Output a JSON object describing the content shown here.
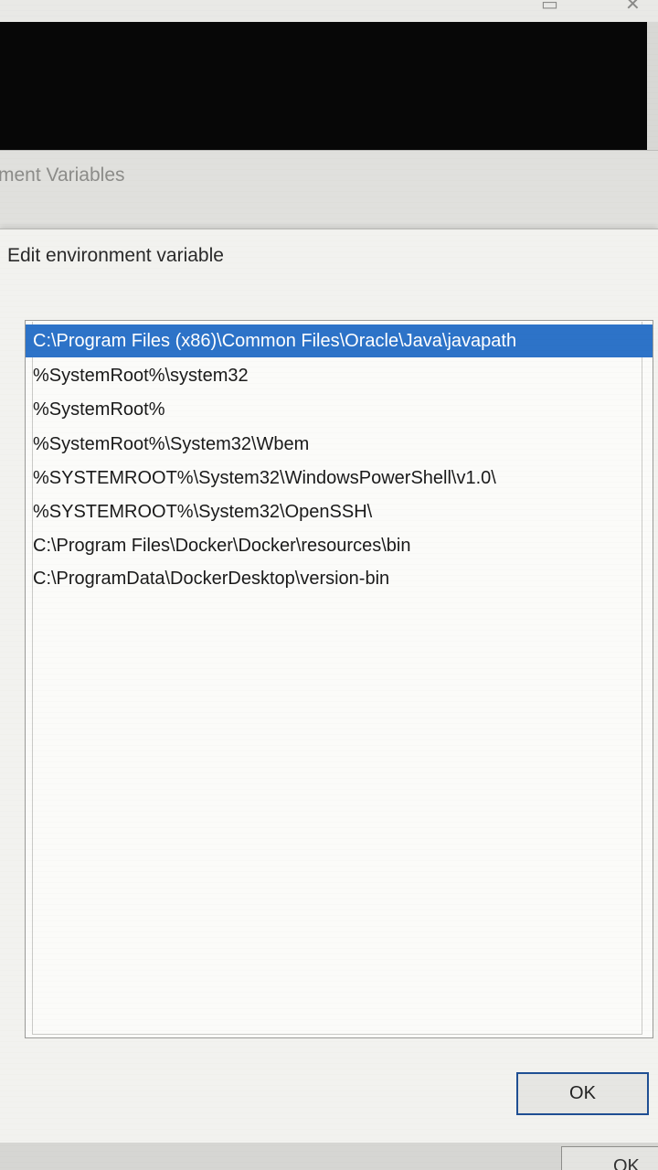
{
  "background_window": {
    "title": "ment Variables"
  },
  "dialog": {
    "title": "Edit environment variable",
    "path_entries": [
      "C:\\Program Files (x86)\\Common Files\\Oracle\\Java\\javapath",
      "%SystemRoot%\\system32",
      "%SystemRoot%",
      "%SystemRoot%\\System32\\Wbem",
      "%SYSTEMROOT%\\System32\\WindowsPowerShell\\v1.0\\",
      "%SYSTEMROOT%\\System32\\OpenSSH\\",
      "C:\\Program Files\\Docker\\Docker\\resources\\bin",
      "C:\\ProgramData\\DockerDesktop\\version-bin"
    ],
    "selected_index": 0,
    "ok_label": "OK"
  },
  "bottom_window": {
    "ok_label_partial": "OK"
  },
  "colors": {
    "selection": "#2d73c8",
    "ok_border": "#1f4f93"
  }
}
